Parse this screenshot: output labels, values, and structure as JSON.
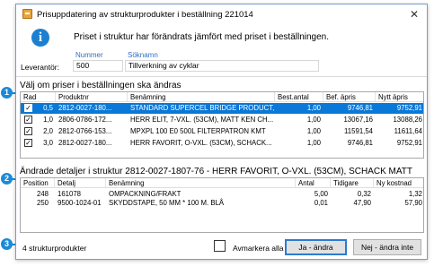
{
  "window": {
    "title": "Prisuppdatering av strukturprodukter i beställning 221014",
    "close_glyph": "✕"
  },
  "info": {
    "icon_glyph": "i",
    "message": "Priset i struktur har förändrats jämfört med priset i beställningen."
  },
  "supplier": {
    "label": "Leverantör:",
    "number_header": "Nummer",
    "search_name_header": "Söknamn",
    "number": "500",
    "search_name": "Tillverkning av cyklar"
  },
  "price_grid": {
    "title": "Välj om priser i beställningen ska ändras",
    "columns": [
      "Rad",
      "Produktnr",
      "Benämning",
      "Best.antal",
      "Bef. äpris",
      "Nytt äpris"
    ],
    "rows": [
      {
        "checked": true,
        "rad": "0,5",
        "produktnr": "2812-0027-180...",
        "benamning": "STANDARD SUPERCEL BRIDGE PRODUCT,...",
        "antal": "1,00",
        "bef": "9746,81",
        "nytt": "9752,91",
        "selected": true
      },
      {
        "checked": true,
        "rad": "1,0",
        "produktnr": "2806-0786-172...",
        "benamning": "HERR ELIT, 7-VXL. (53CM), MATT KEN CH...",
        "antal": "1,00",
        "bef": "13067,16",
        "nytt": "13088,26",
        "selected": false
      },
      {
        "checked": true,
        "rad": "2,0",
        "produktnr": "2812-0766-153...",
        "benamning": "MPXPL 100 E0 500L FILTERPATRON KMT",
        "antal": "1,00",
        "bef": "11591,54",
        "nytt": "11611,64",
        "selected": false
      },
      {
        "checked": true,
        "rad": "3,0",
        "produktnr": "2812-0027-180...",
        "benamning": "HERR FAVORIT, O-VXL. (53CM), SCHACK...",
        "antal": "1,00",
        "bef": "9746,81",
        "nytt": "9752,91",
        "selected": false
      }
    ]
  },
  "detail_grid": {
    "title": "Ändrade detaljer i struktur 2812-0027-1807-76 - HERR  FAVORIT, O-VXL. (53CM), SCHACK MATT",
    "columns": [
      "Position",
      "Detalj",
      "Benämning",
      "Antal",
      "Tidigare",
      "Ny kostnad"
    ],
    "rows": [
      {
        "position": "248",
        "detalj": "161078",
        "benamning": "OMPACKNING/FRAKT",
        "antal": "5,00",
        "tidigare": "0,32",
        "ny": "1,32"
      },
      {
        "position": "250",
        "detalj": "9500-1024-01",
        "benamning": "SKYDDSTAPE, 50 MM * 100 M. BLÅ",
        "antal": "0,01",
        "tidigare": "47,90",
        "ny": "57,90"
      }
    ]
  },
  "footer": {
    "count_text": "4 strukturprodukter",
    "deselect_all_label": "Avmarkera alla",
    "yes_button": "Ja - ändra",
    "no_button": "Nej - ändra inte"
  },
  "callouts": [
    "1",
    "2",
    "3"
  ],
  "colors": {
    "selection": "#0a78d7",
    "callout": "#1b8ad8",
    "link_header": "#2d6ec9"
  }
}
